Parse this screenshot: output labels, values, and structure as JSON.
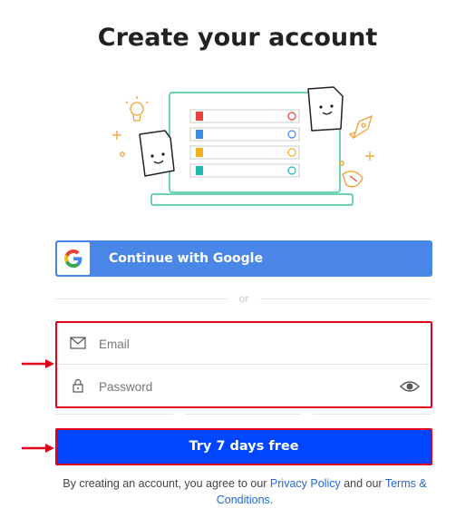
{
  "page": {
    "title": "Create your account"
  },
  "google_button": {
    "label": "Continue with Google"
  },
  "divider": {
    "text": "or"
  },
  "form": {
    "email_placeholder": "Email",
    "password_placeholder": "Password"
  },
  "cta": {
    "label": "Try 7 days free"
  },
  "legal": {
    "prefix": "By creating an account, you agree to our",
    "privacy_link": "Privacy Policy",
    "middle": "and our",
    "terms_link": "Terms & Conditions",
    "suffix": "."
  },
  "colors": {
    "google_blue": "#4a86e8",
    "cta_blue": "#0045ff",
    "annotation_red": "#e1001a",
    "link_blue": "#2467d6"
  }
}
